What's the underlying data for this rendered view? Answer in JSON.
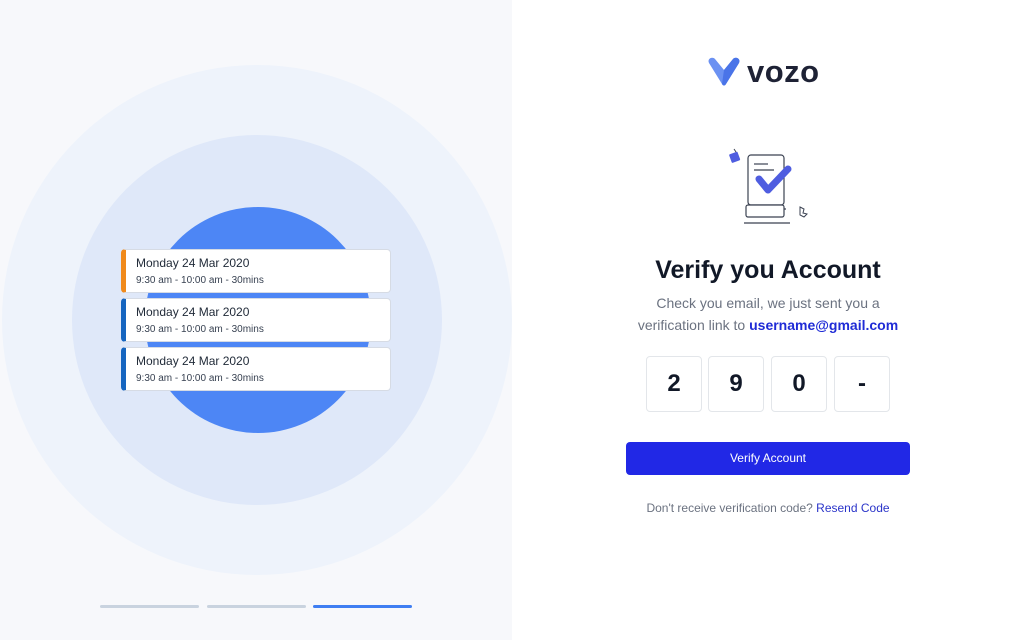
{
  "brand": {
    "name": "vozo",
    "accent": "#2128e6",
    "logo_color": "#5b84f0"
  },
  "appointments": [
    {
      "date": "Monday 24 Mar 2020",
      "time": "9:30 am - 10:00 am - 30mins",
      "accent": "#f08a1c"
    },
    {
      "date": "Monday 24 Mar 2020",
      "time": "9:30 am - 10:00 am - 30mins",
      "accent": "#1565c0"
    },
    {
      "date": "Monday 24 Mar 2020",
      "time": "9:30 am - 10:00 am - 30mins",
      "accent": "#1565c0"
    }
  ],
  "carousel": {
    "slides": 3,
    "active_index": 2
  },
  "verify": {
    "title": "Verify you Account",
    "subtitle_line1": "Check you email, we just sent you a",
    "subtitle_prefix": "verification link to",
    "email": "username@gmail.com",
    "code_digits": [
      "2",
      "9",
      "0",
      "-"
    ],
    "button_label": "Verify Account",
    "resend_prompt": "Don't receive verification code?",
    "resend_link": "Resend Code"
  },
  "icons": {
    "logo": "vozo-heart-logo-icon",
    "illustration": "document-checkmark-icon"
  }
}
